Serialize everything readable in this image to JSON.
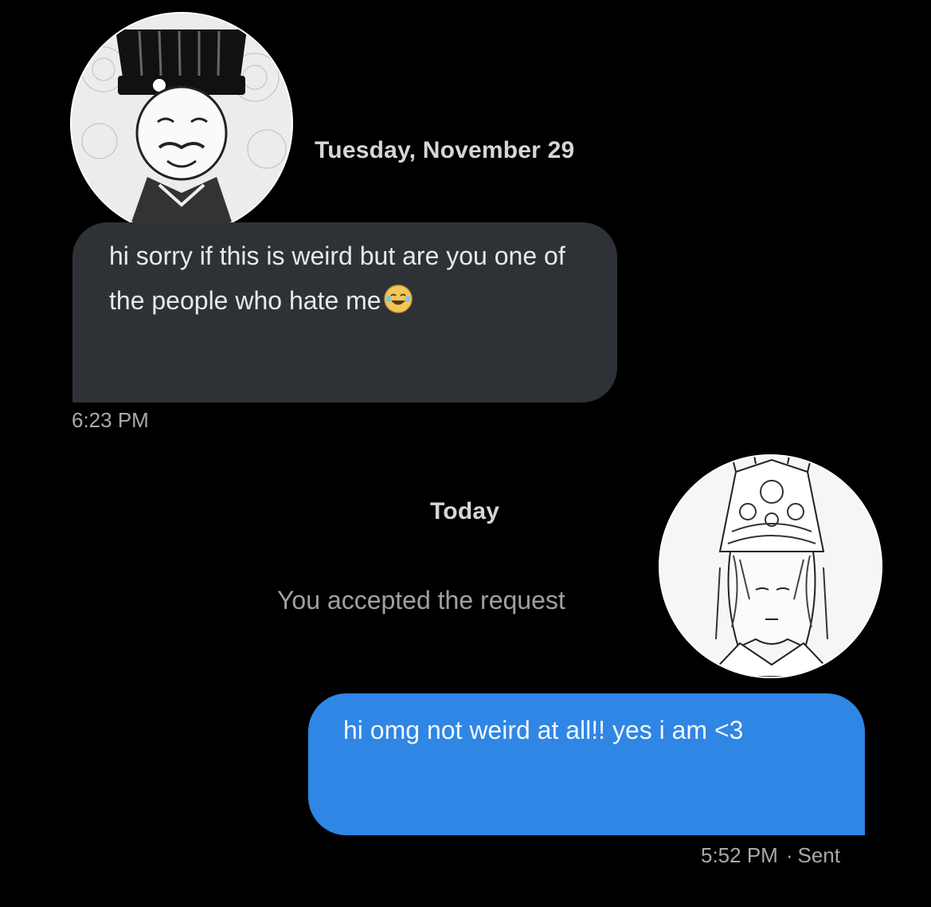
{
  "conversation": {
    "date_header_1": "Tuesday, November 29",
    "received_message": {
      "text": "hi sorry if this is weird but are you one of the people who hate me",
      "emoji": "laughing-crying-face",
      "time": "6:23 PM"
    },
    "date_header_2": "Today",
    "system_note": "You accepted the request",
    "sent_message": {
      "text": "hi omg not weird at all!! yes i am <3",
      "time": "5:52 PM",
      "separator": "·",
      "status": "Sent"
    }
  },
  "avatars": {
    "left": "manga-character-black-hat-avatar",
    "right": "manga-character-crown-avatar"
  },
  "colors": {
    "background": "#000000",
    "received_bubble": "#2e3237",
    "sent_bubble": "#2f86e4",
    "timestamp": "#a9a9ad"
  }
}
